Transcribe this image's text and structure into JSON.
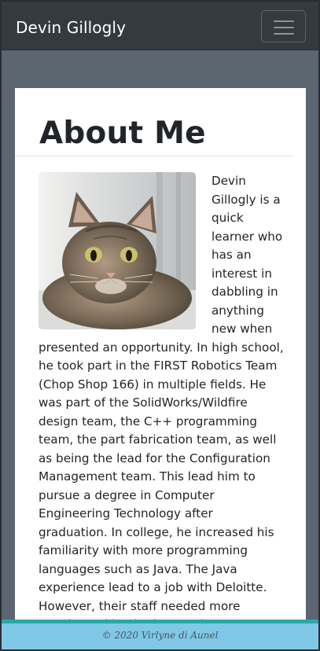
{
  "navbar": {
    "brand": "Devin Gillogly",
    "toggle_icon": "hamburger-menu-icon"
  },
  "main": {
    "title": "About Me",
    "photo_description": "kitten photo",
    "bio": "Devin Gillogly is a quick learner who has an interest in dabbling in anything new when presented an opportunity. In high school, he took part in the FIRST Robotics Team (Chop Shop 166) in multiple fields. He was part of the SolidWorks/Wildfire design team, the C++ programming team, the part fabrication team, as well as being the lead for the Configuration Management team. This lead him to pursue a degree in Computer Engineering Technology after graduation. In college, he increased his familiarity with more programming languages such as Java. The Java experience lead to a job with Deloitte. However, their staff needed more people working in the Oracle teams, so Devin"
  },
  "footer": {
    "text": "© 2020 Virlyne di Aunel"
  },
  "colors": {
    "navbar_bg": "#343a40",
    "page_bg": "#5b6670",
    "footer_bg": "#7fc8e6",
    "footer_border": "#2aa8a8"
  }
}
